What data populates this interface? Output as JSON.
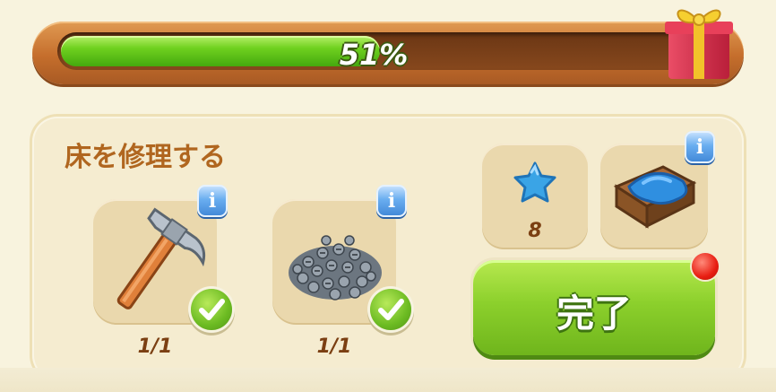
{
  "progress": {
    "percent_label": "51%",
    "fraction": 0.51
  },
  "task": {
    "title": "床を修理する",
    "materials": [
      {
        "icon": "hammer-icon",
        "count_label": "1/1",
        "completed": true
      },
      {
        "icon": "screws-pile-icon",
        "count_label": "1/1",
        "completed": true
      }
    ],
    "reward": {
      "star_icon": "blue-star-icon",
      "star_amount": "8",
      "item_icon": "blue-cushion-crate-icon"
    },
    "complete_button_label": "完了",
    "info_glyph": "i"
  },
  "colors": {
    "progress_green": "#6fd11f",
    "button_green": "#8cd02c",
    "title_brown": "#b0661f",
    "notify_red": "#e81e12"
  }
}
